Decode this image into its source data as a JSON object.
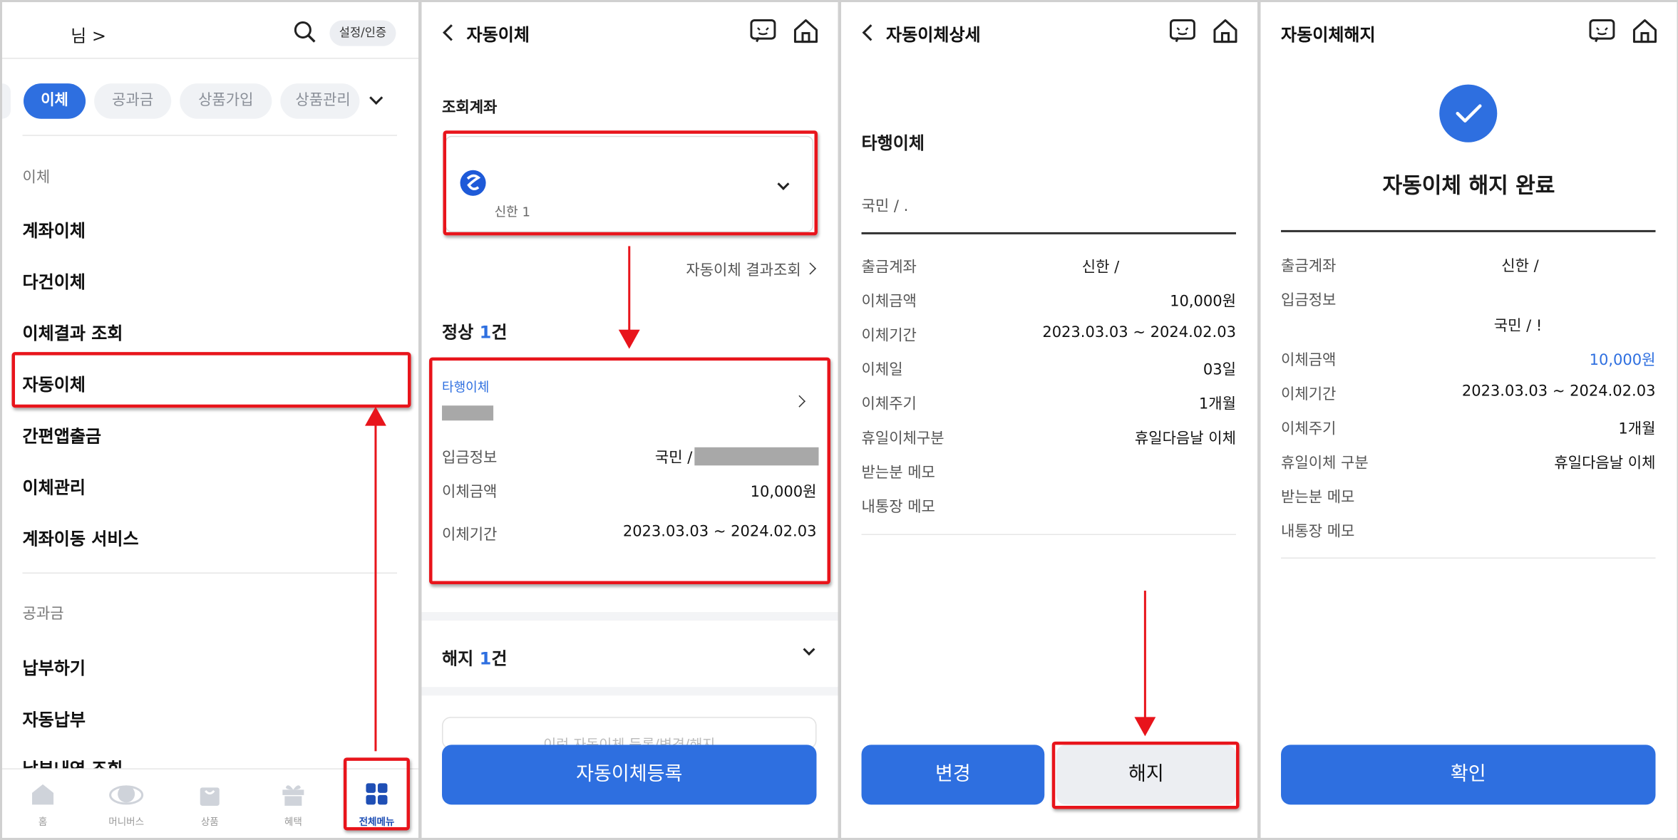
{
  "screen1": {
    "greeting": "님 >",
    "settings_chip": "설정/인증",
    "chips": [
      "이체",
      "공과금",
      "상품가입",
      "상품관리"
    ],
    "section_transfer": "이체",
    "transfer_items": [
      "계좌이체",
      "다건이체",
      "이체결과 조회",
      "자동이체",
      "간편앱출금",
      "이체관리",
      "계좌이동 서비스"
    ],
    "section_bill": "공과금",
    "bill_items": [
      "납부하기",
      "자동납부",
      "납부내역 조회"
    ],
    "tabs": [
      "홈",
      "머니버스",
      "상품",
      "혜택",
      "전체메뉴"
    ]
  },
  "screen2": {
    "title": "자동이체",
    "account_label": "조회계좌",
    "account_name": "신한 1",
    "result_link": "자동이체 결과조회",
    "normal_prefix": "정상 ",
    "normal_count": "1",
    "normal_suffix": "건",
    "item_type": "타행이체",
    "deposit_label": "입금정보",
    "deposit_value": "국민 /",
    "amount_label": "이체금액",
    "amount_value": "10,000원",
    "period_label": "이체기간",
    "period_value": "2023.03.03 ~ 2024.02.03",
    "cancel_prefix": "해지 ",
    "cancel_count": "1",
    "cancel_suffix": "건",
    "faded_text": "이런 자동이체 등록/변경/해지",
    "register_button": "자동이체등록"
  },
  "screen3": {
    "title": "자동이체상세",
    "section": "타행이체",
    "account_line": "국민 / .",
    "rows": [
      {
        "label": "출금계좌",
        "value": "신한 /"
      },
      {
        "label": "이체금액",
        "value": "10,000원"
      },
      {
        "label": "이체기간",
        "value": "2023.03.03 ~ 2024.02.03"
      },
      {
        "label": "이체일",
        "value": "03일"
      },
      {
        "label": "이체주기",
        "value": "1개월"
      },
      {
        "label": "휴일이체구분",
        "value": "휴일다음날 이체"
      },
      {
        "label": "받는분 메모",
        "value": ""
      },
      {
        "label": "내통장 메모",
        "value": ""
      }
    ],
    "change_button": "변경",
    "cancel_button": "해지"
  },
  "screen4": {
    "title": "자동이체해지",
    "complete_text": "자동이체 해지 완료",
    "withdraw_label": "출금계좌",
    "withdraw_value": "신한 /",
    "deposit_label": "입금정보",
    "deposit_value": "국민 / !",
    "rows": [
      {
        "label": "이체금액",
        "value": "10,000원"
      },
      {
        "label": "이체기간",
        "value": "2023.03.03 ~ 2024.02.03"
      },
      {
        "label": "이체주기",
        "value": "1개월"
      },
      {
        "label": "휴일이체 구분",
        "value": "휴일다음날 이체"
      },
      {
        "label": "받는분 메모",
        "value": ""
      },
      {
        "label": "내통장 메모",
        "value": ""
      }
    ],
    "confirm_button": "확인"
  },
  "colors": {
    "accent": "#2e6fe0",
    "highlight": "#e8141b"
  }
}
